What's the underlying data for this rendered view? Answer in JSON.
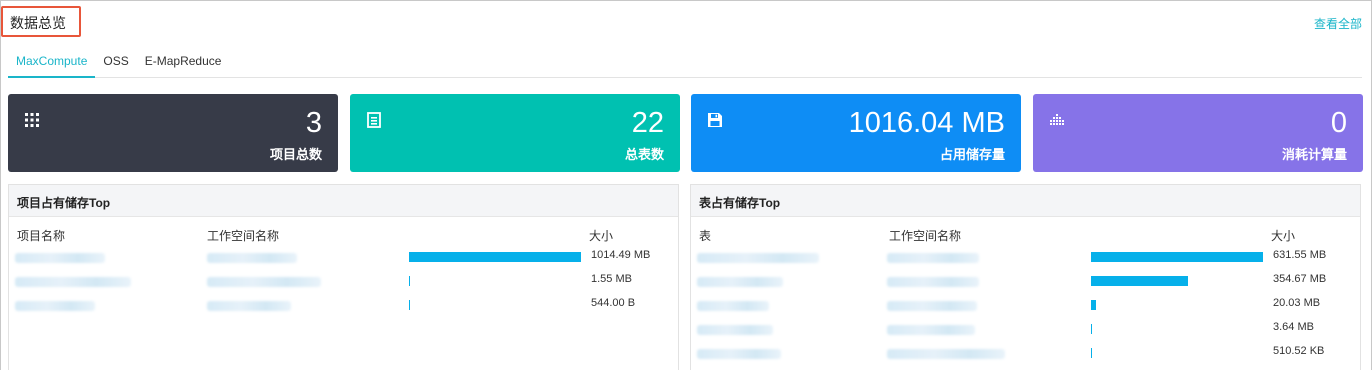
{
  "page": {
    "title": "数据总览",
    "view_all": "查看全部"
  },
  "tabs": [
    {
      "label": "MaxCompute",
      "active": true
    },
    {
      "label": "OSS",
      "active": false
    },
    {
      "label": "E-MapReduce",
      "active": false
    }
  ],
  "cards": [
    {
      "value": "3",
      "label": "项目总数",
      "icon": "grid-icon",
      "color": "#373b48"
    },
    {
      "value": "22",
      "label": "总表数",
      "icon": "document-list-icon",
      "color": "#00c1b1"
    },
    {
      "value": "1016.04 MB",
      "label": "占用储存量",
      "icon": "save-disk-icon",
      "color": "#0e8df5"
    },
    {
      "value": "0",
      "label": "消耗计算量",
      "icon": "compute-bars-icon",
      "color": "#8673e8"
    }
  ],
  "project_panel": {
    "title": "项目占有储存Top",
    "headers": {
      "name": "项目名称",
      "workspace": "工作空间名称",
      "size": "大小"
    },
    "rows": [
      {
        "size": "1014.49 MB",
        "fraction": 1.0
      },
      {
        "size": "1.55 MB",
        "fraction": 0.0015
      },
      {
        "size": "544.00 B",
        "fraction": 0.0
      }
    ]
  },
  "table_panel": {
    "title": "表占有储存Top",
    "headers": {
      "name": "表",
      "workspace": "工作空间名称",
      "size": "大小"
    },
    "rows": [
      {
        "size": "631.55 MB",
        "fraction": 1.0
      },
      {
        "size": "354.67 MB",
        "fraction": 0.5616
      },
      {
        "size": "20.03 MB",
        "fraction": 0.0317
      },
      {
        "size": "3.64 MB",
        "fraction": 0.0058
      },
      {
        "size": "510.52 KB",
        "fraction": 0.0008
      }
    ]
  },
  "colors": {
    "accent": "#1ab5c9",
    "bar": "#06b0ea",
    "highlight_box": "#e8563a"
  }
}
